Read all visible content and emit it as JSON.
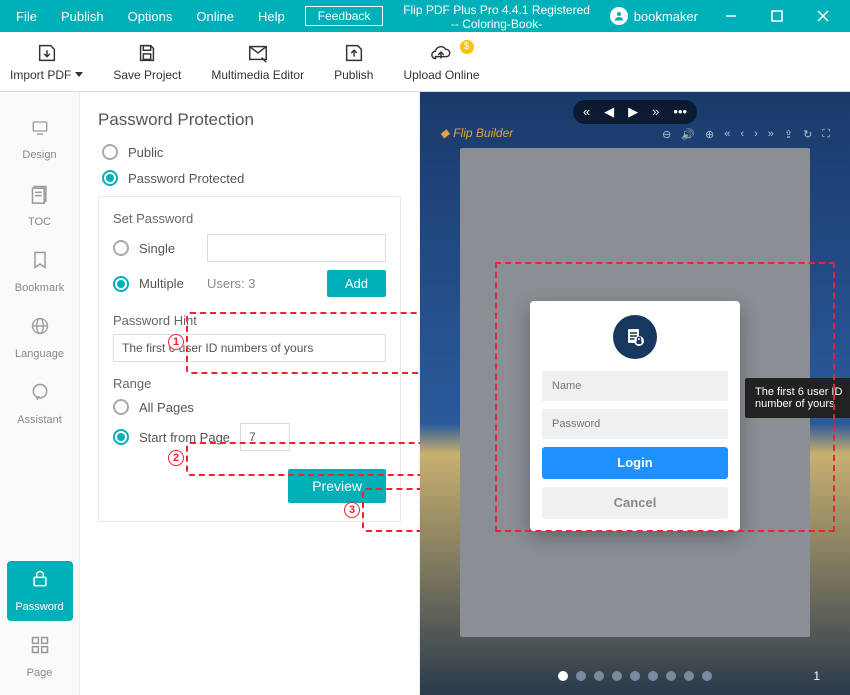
{
  "menubar": {
    "items": [
      "File",
      "Publish",
      "Options",
      "Online",
      "Help"
    ],
    "feedback": "Feedback",
    "title_line1": "Flip PDF Plus Pro 4.4.1 Registered",
    "title_line2": "-- Coloring-Book-",
    "username": "bookmaker"
  },
  "toolbar": {
    "import": "Import PDF",
    "save": "Save Project",
    "mm": "Multimedia Editor",
    "publish": "Publish",
    "upload": "Upload Online"
  },
  "sidebar": {
    "items": [
      {
        "label": "Design"
      },
      {
        "label": "TOC"
      },
      {
        "label": "Bookmark"
      },
      {
        "label": "Language"
      },
      {
        "label": "Assistant"
      },
      {
        "label": "Password"
      },
      {
        "label": "Page"
      }
    ]
  },
  "panel": {
    "heading": "Password Protection",
    "public": "Public",
    "protected": "Password Protected",
    "setpw": "Set Password",
    "single": "Single",
    "multiple": "Multiple",
    "users": "Users: 3",
    "add": "Add",
    "hint_label": "Password Hint",
    "hint_value": "The first 6 user ID numbers of yours",
    "range": "Range",
    "allpages": "All Pages",
    "startfrom": "Start from Page",
    "startval": "7",
    "preview": "Preview"
  },
  "annot": {
    "a1": "1",
    "a2": "2",
    "a3": "3"
  },
  "preview": {
    "brand": "Flip Builder",
    "login_name_ph": "Name",
    "login_pw_ph": "Password",
    "login_btn": "Login",
    "cancel_btn": "Cancel",
    "tooltip": "The first 6 user ID number of yours",
    "page_number": "1"
  }
}
